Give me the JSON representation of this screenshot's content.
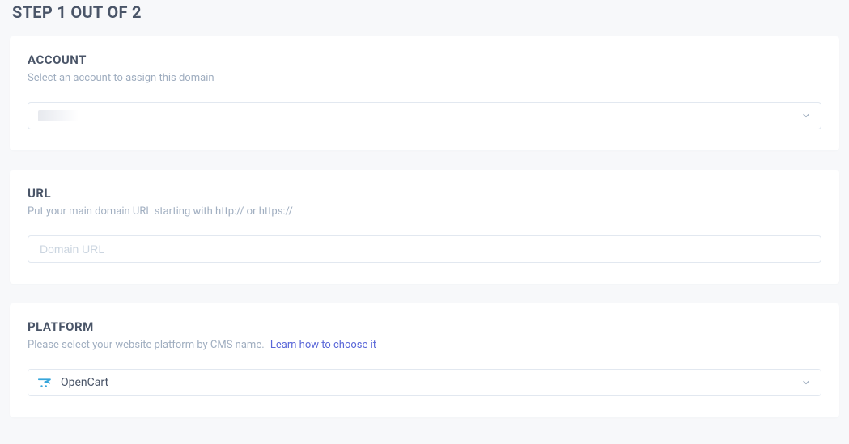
{
  "step": {
    "title": "STEP 1 OUT OF 2"
  },
  "account": {
    "label": "ACCOUNT",
    "desc": "Select an account to assign this domain",
    "selected": ""
  },
  "url": {
    "label": "URL",
    "desc": "Put your main domain URL starting with http:// or https://",
    "placeholder": "Domain URL",
    "value": ""
  },
  "platform": {
    "label": "PLATFORM",
    "desc": "Please select your website platform by CMS name.",
    "link_text": "Learn how to choose it",
    "selected": "OpenCart"
  }
}
